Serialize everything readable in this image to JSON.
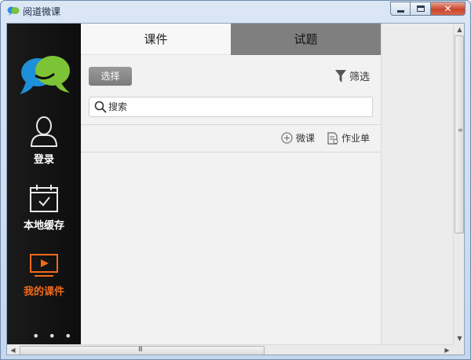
{
  "window": {
    "title": "阅道微课",
    "icon": "app-logo-icon",
    "minimize_glyph": "minimize-icon",
    "maximize_glyph": "maximize-icon",
    "close_glyph": "✕"
  },
  "sidebar": {
    "logo_icon": "speech-bubbles-logo-icon",
    "items": [
      {
        "label": "登录",
        "icon": "user-icon",
        "active": false
      },
      {
        "label": "本地缓存",
        "icon": "calendar-check-icon",
        "active": false
      },
      {
        "label": "我的课件",
        "icon": "play-screen-icon",
        "active": true
      }
    ],
    "more": "• • •",
    "active_color": "#f06a1c"
  },
  "tabs": [
    {
      "label": "课件",
      "active": true
    },
    {
      "label": "试题",
      "active": false
    }
  ],
  "toolbar": {
    "select_label": "选择",
    "filter_label": "筛选"
  },
  "search": {
    "placeholder": "搜索",
    "value": ""
  },
  "actions": [
    {
      "label": "微课",
      "icon": "plus-circle-icon"
    },
    {
      "label": "作业单",
      "icon": "document-icon"
    }
  ],
  "scrollbars": {
    "horizontal_grip": "III",
    "vertical_grip": "≡"
  }
}
